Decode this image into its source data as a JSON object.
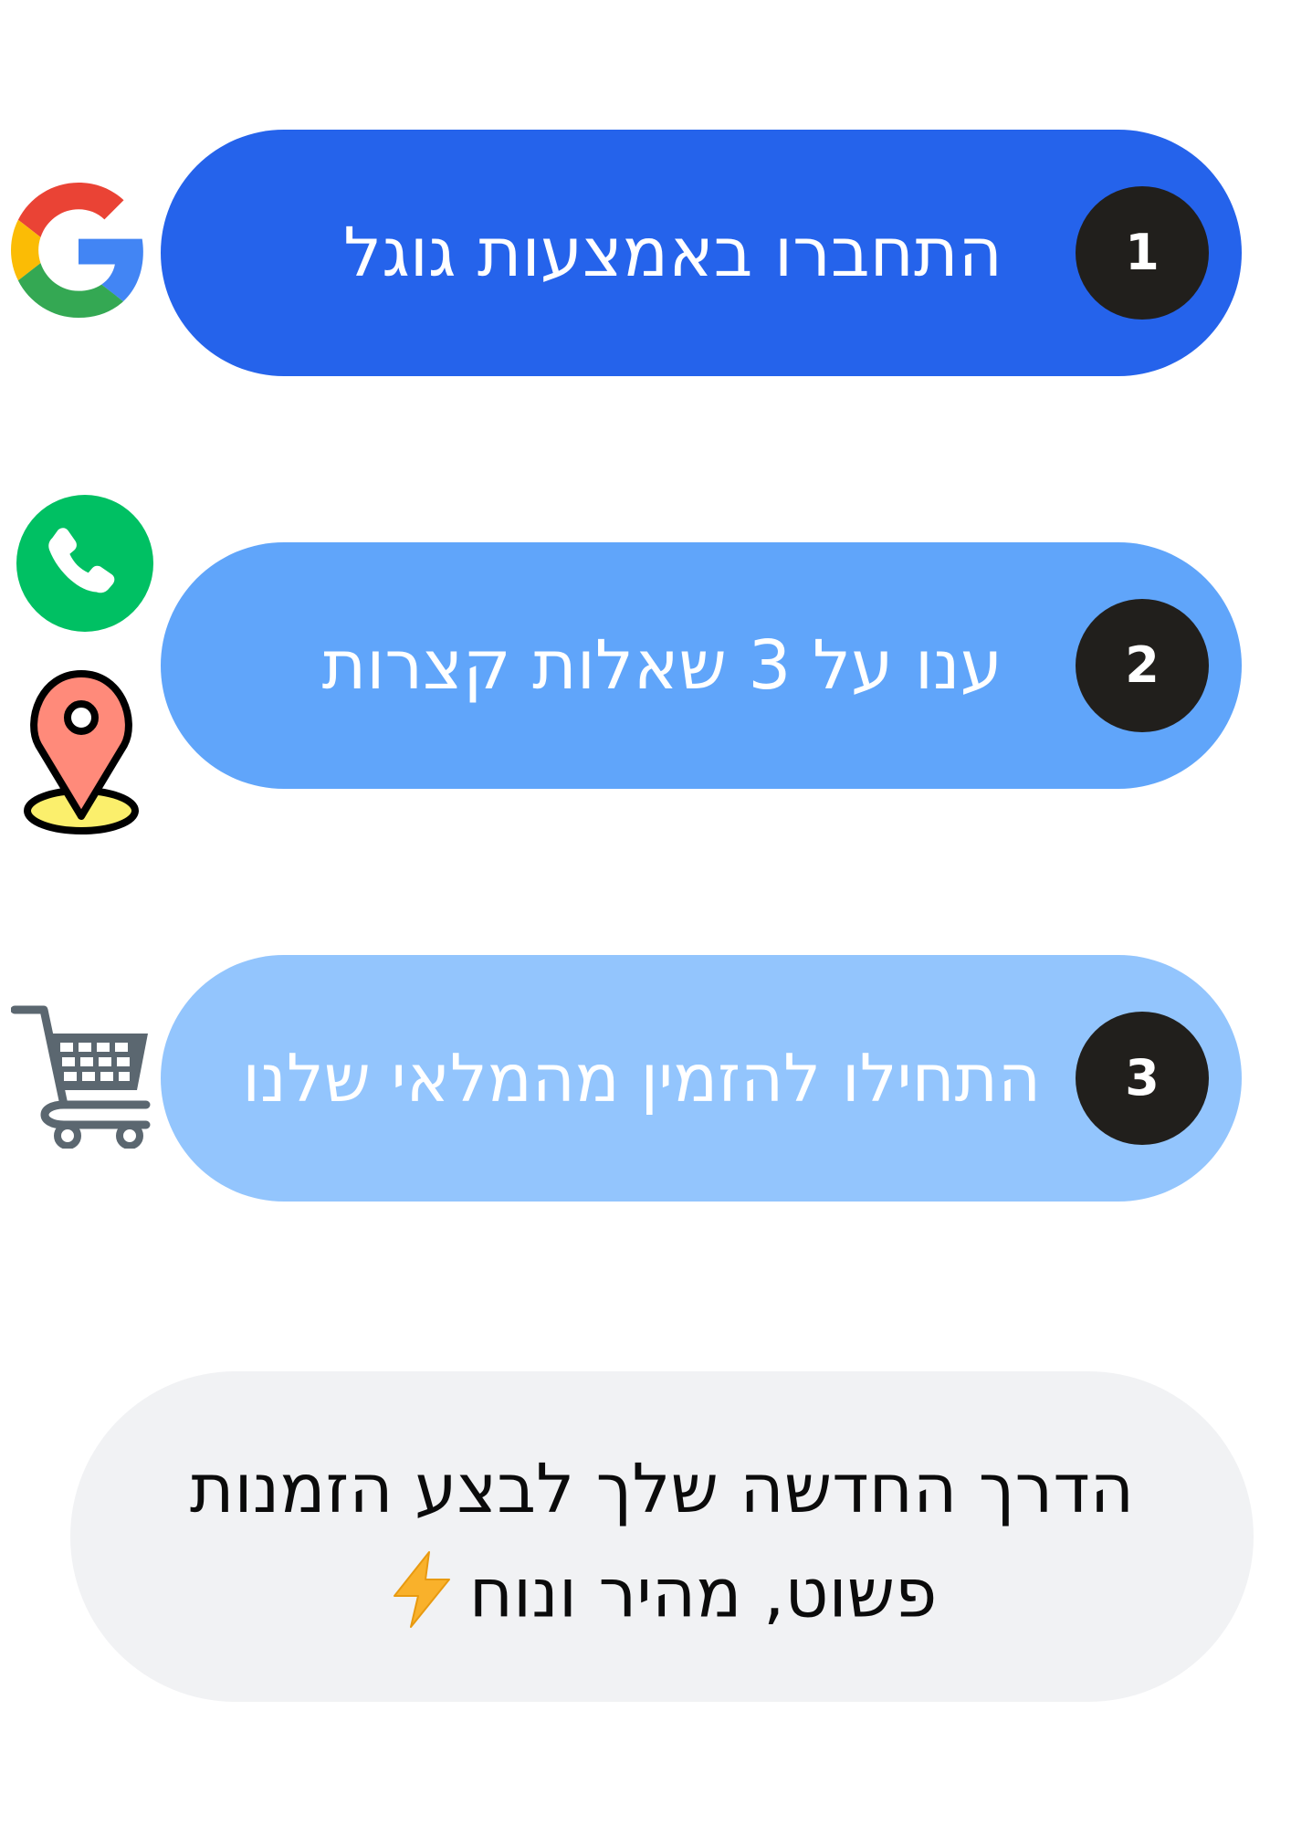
{
  "steps": [
    {
      "number": "1",
      "label": "התחברו באמצעות גוגל",
      "color": "#2563eb",
      "icon": "google-g-icon"
    },
    {
      "number": "2",
      "label": "ענו על 3 שאלות קצרות",
      "color": "#60a5fa",
      "icon": "phone-icon"
    },
    {
      "number": "3",
      "label": "התחילו להזמין מהמלאי שלנו",
      "color": "#93c5fd",
      "icon": "shopping-cart-icon"
    }
  ],
  "extra_icon": "map-pin-icon",
  "footer": {
    "line1": "הדרך החדשה שלך לבצע הזמנות",
    "line2": "פשוט, מהיר ונוח",
    "emoji": "lightning-icon"
  },
  "colors": {
    "badge": "#211f1c",
    "footer_bg": "#f1f2f4"
  }
}
